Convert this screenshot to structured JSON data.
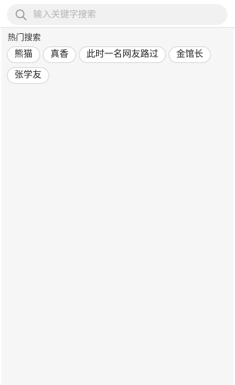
{
  "search": {
    "placeholder": "输入关键字搜索",
    "value": ""
  },
  "hot_search": {
    "title": "热门搜索",
    "tags": [
      {
        "label": "熊猫"
      },
      {
        "label": "真香"
      },
      {
        "label": "此时一名网友路过"
      },
      {
        "label": "金馆长"
      },
      {
        "label": "张学友"
      }
    ]
  },
  "icons": {
    "search": "search-icon"
  },
  "colors": {
    "search_box_bg": "#f1f1f1",
    "content_bg": "#f6f6f6",
    "tag_border": "#d4d4d4",
    "placeholder": "#b6b6b6"
  }
}
